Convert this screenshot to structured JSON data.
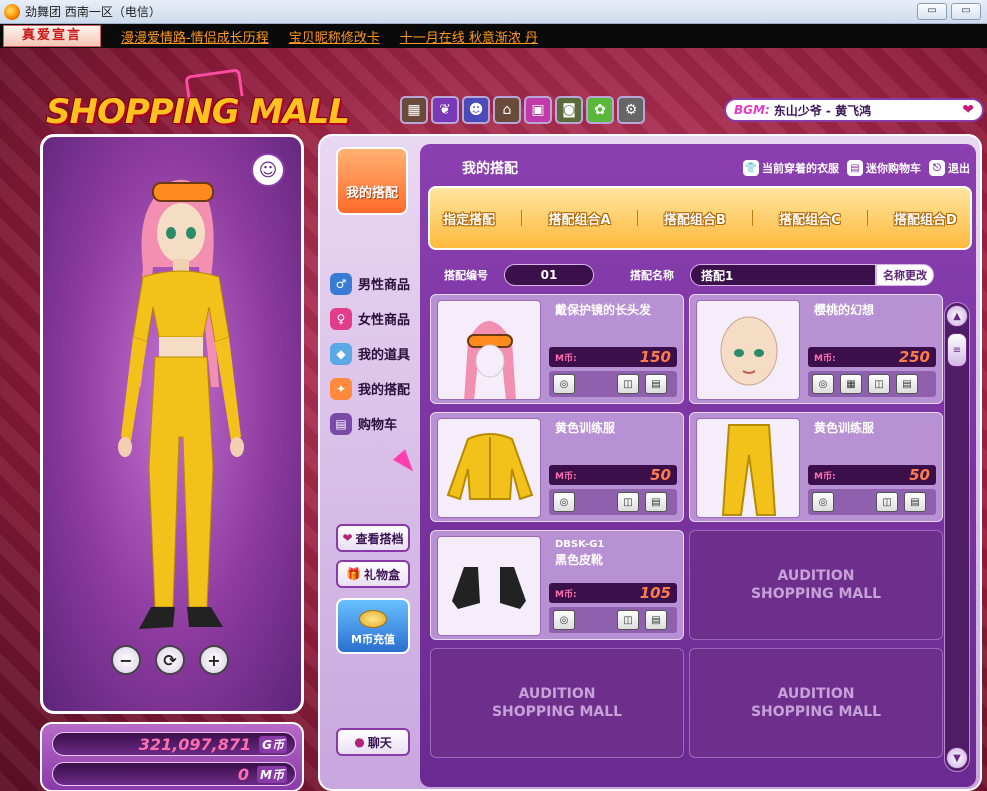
{
  "window": {
    "title": "劲舞团 西南一区（电信）",
    "min_label": "▭",
    "max_label": "▭"
  },
  "newsbar": {
    "tag": "真爱宣言",
    "items": [
      "漫漫爱情路-情侣成长历程",
      "宝贝昵称修改卡",
      "十一月在线  秋意渐浓 丹"
    ]
  },
  "logo": {
    "text": "SHOPPING MALL"
  },
  "toolbar_icons": [
    "room-icon",
    "wing-icon",
    "face-icon",
    "house-icon",
    "tv-icon",
    "photo-icon",
    "garden-icon",
    "gear-icon"
  ],
  "bgm": {
    "label": "BGM:",
    "track": "东山少爷 - 黄飞鸿"
  },
  "character": {
    "avatar_glyph": "☺",
    "controls": [
      "−",
      "⟳",
      "+"
    ]
  },
  "money": {
    "g_value": "321,097,871",
    "g_unit": "G币",
    "m_value": "0",
    "m_unit": "M币"
  },
  "nav": {
    "badge": "我的搭配",
    "items": [
      {
        "label": "男性商品",
        "icon": "male-icon",
        "color": "#3a7bd5"
      },
      {
        "label": "女性商品",
        "icon": "female-icon",
        "color": "#e23c8a"
      },
      {
        "label": "我的道具",
        "icon": "cube-icon",
        "color": "#5aa8e6"
      },
      {
        "label": "我的搭配",
        "icon": "outfit-icon",
        "color": "#ff8a3c"
      },
      {
        "label": "购物车",
        "icon": "cart-icon",
        "color": "#7a4aa8"
      }
    ],
    "view_outfit": "查看搭档",
    "gift_box": "礼物盒",
    "mcoin_recharge": "M币充值",
    "chat": "聊天"
  },
  "main": {
    "title": "我的搭配",
    "top_links": [
      "当前穿着的衣服",
      "迷你购物车",
      "退出"
    ],
    "combos": [
      "指定搭配",
      "搭配组合A",
      "搭配组合B",
      "搭配组合C",
      "搭配组合D"
    ],
    "outfit_no_label": "搭配编号",
    "outfit_no": "01",
    "outfit_name_label": "搭配名称",
    "outfit_name": "搭配1",
    "rename": "名称更改"
  },
  "items": [
    {
      "code": "",
      "name": "戴保护镜的长头发",
      "price_label": "M币:",
      "price": "150",
      "thumb": "hair",
      "btns": 3
    },
    {
      "code": "",
      "name": "樱桃的幻想",
      "price_label": "M币:",
      "price": "250",
      "thumb": "face",
      "btns": 4
    },
    {
      "code": "",
      "name": "黄色训练服",
      "price_label": "M币:",
      "price": "50",
      "thumb": "jacket",
      "btns": 3
    },
    {
      "code": "",
      "name": "黄色训练服",
      "price_label": "M币:",
      "price": "50",
      "thumb": "pants",
      "btns": 3
    },
    {
      "code": "DBSK-G1",
      "name": "黑色皮靴",
      "price_label": "M币:",
      "price": "105",
      "thumb": "boots",
      "btns": 3
    }
  ],
  "empty_slot": {
    "line1": "AUDITION",
    "line2": "SHOPPING MALL"
  },
  "colors": {
    "accent": "#8a3aa8",
    "price": "#ff7b4a",
    "combo_bg": "#ffb93c",
    "money": "#ff6fb0"
  }
}
